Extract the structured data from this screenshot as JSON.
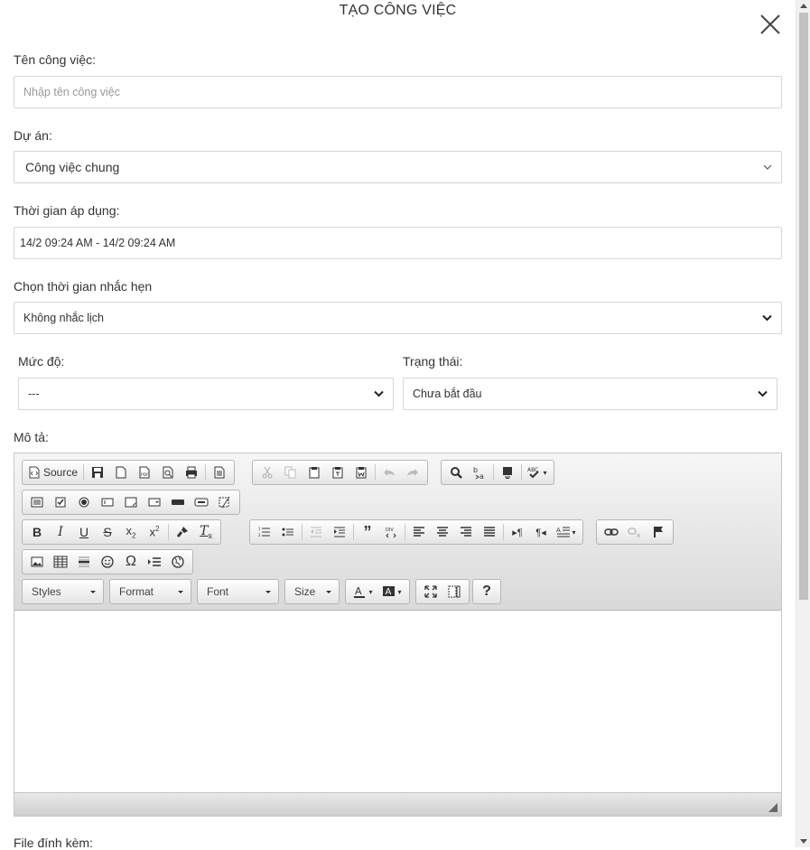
{
  "modal": {
    "title": "TẠO CÔNG VIỆC"
  },
  "form": {
    "task_name_label": "Tên công việc:",
    "task_name_placeholder": "Nhập tên công việc",
    "project_label": "Dự án:",
    "project_value": "Công việc chung",
    "time_label": "Thời gian áp dụng:",
    "time_value": "14/2 09:24 AM - 14/2 09:24 AM",
    "reminder_label": "Chọn thời gian nhắc hẹn",
    "reminder_value": "Không nhắc lịch",
    "priority_label": "Mức độ:",
    "priority_value": "---",
    "status_label": "Trạng thái:",
    "status_value": "Chưa bắt đầu",
    "description_label": "Mô tả:",
    "attachment_label": "File đính kèm:"
  },
  "editor": {
    "source_label": "Source",
    "styles_label": "Styles",
    "format_label": "Format",
    "font_label": "Font",
    "size_label": "Size",
    "help_label": "?",
    "content": ""
  }
}
